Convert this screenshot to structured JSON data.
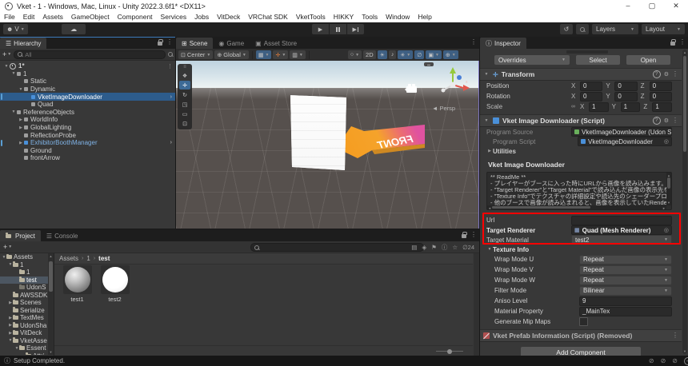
{
  "window": {
    "title": "Vket - 1 - Windows, Mac, Linux - Unity 2022.3.6f1* <DX11>",
    "minimize": "–",
    "maximize": "▢",
    "close": "✕"
  },
  "menubar": [
    "File",
    "Edit",
    "Assets",
    "GameObject",
    "Component",
    "Services",
    "Jobs",
    "VitDeck",
    "VRChat SDK",
    "VketTools",
    "HIKKY",
    "Tools",
    "Window",
    "Help"
  ],
  "toolbar": {
    "account_label": "V",
    "layers_label": "Layers",
    "layout_label": "Layout"
  },
  "hierarchy": {
    "tab": "Hierarchy",
    "search_placeholder": "All",
    "items": [
      {
        "label": "1*",
        "depth": 0,
        "arrow": "▼",
        "icon": "scene",
        "kebab": true
      },
      {
        "label": "1",
        "depth": 1,
        "arrow": "▼",
        "icon": "go"
      },
      {
        "label": "Static",
        "depth": 2,
        "arrow": "",
        "icon": "go"
      },
      {
        "label": "Dynamic",
        "depth": 2,
        "arrow": "▼",
        "icon": "go"
      },
      {
        "label": "VketImageDownloader",
        "depth": 3,
        "arrow": "",
        "icon": "prefab",
        "selected": true,
        "edge": true,
        "chevron": "›"
      },
      {
        "label": "Quad",
        "depth": 3,
        "arrow": "",
        "icon": "go"
      },
      {
        "label": "ReferenceObjects",
        "depth": 1,
        "arrow": "▼",
        "icon": "go"
      },
      {
        "label": "WorldInfo",
        "depth": 2,
        "arrow": "▶",
        "icon": "go"
      },
      {
        "label": "GlobalLighting",
        "depth": 2,
        "arrow": "▶",
        "icon": "go"
      },
      {
        "label": "ReflectionProbe",
        "depth": 2,
        "arrow": "",
        "icon": "go"
      },
      {
        "label": "ExhibitorBoothManager",
        "depth": 2,
        "arrow": "▶",
        "icon": "prefab",
        "blue": true,
        "edge": true,
        "chevron": "›"
      },
      {
        "label": "Ground",
        "depth": 2,
        "arrow": "",
        "icon": "go"
      },
      {
        "label": "frontArrow",
        "depth": 2,
        "arrow": "",
        "icon": "go"
      }
    ]
  },
  "scene": {
    "tabs": [
      {
        "label": "Scene",
        "active": true
      },
      {
        "label": "Game",
        "active": false
      },
      {
        "label": "Asset Store",
        "active": false
      }
    ],
    "toolbar": {
      "pivot": "Center",
      "orientation": "Global",
      "mode2d": "2D"
    },
    "persp_label": "Persp",
    "front_text": "FRONT"
  },
  "inspector": {
    "tab": "Inspector",
    "overrides_label": "Overrides",
    "select_label": "Select",
    "open_label": "Open",
    "transform": {
      "title": "Transform",
      "rows": [
        {
          "label": "Position",
          "x": "0",
          "y": "0",
          "z": "0",
          "link": false
        },
        {
          "label": "Rotation",
          "x": "0",
          "y": "0",
          "z": "0",
          "link": false
        },
        {
          "label": "Scale",
          "x": "1",
          "y": "1",
          "z": "1",
          "link": true
        }
      ]
    },
    "script": {
      "title": "Vket Image Downloader (Script)",
      "program_source_label": "Program Source",
      "program_source_value": "VketImageDownloader (Udon Sharp",
      "program_script_label": "Program Script",
      "program_script_value": "VketImageDownloader",
      "utilities_label": "Utilities",
      "box_title": "Vket Image Downloader",
      "readme_lines": [
        "** ReadMe **",
        "- プレイヤーがブースに入った時にURLから画像を読み込みます。",
        "- \"Target Renderer\"と\"Target Material\"で読み込んだ画像の表示先を指",
        "- \"Texture Info\"でテクスチャの詳細設定や読込先のシェーダープロパティを設定",
        "- 他のブースで画像が読み込まれると、画像を表示していたRendererは読み込"
      ],
      "url_label": "Url",
      "url_value": "",
      "target_renderer_label": "Target Renderer",
      "target_renderer_value": "Quad (Mesh Renderer)",
      "target_material_label": "Target Material",
      "target_material_value": "test2",
      "texture_info_label": "Texture Info",
      "props": [
        {
          "label": "Wrap Mode U",
          "value": "Repeat",
          "type": "dropdown"
        },
        {
          "label": "Wrap Mode V",
          "value": "Repeat",
          "type": "dropdown"
        },
        {
          "label": "Wrap Mode W",
          "value": "Repeat",
          "type": "dropdown"
        },
        {
          "label": "Filter Mode",
          "value": "Bilinear",
          "type": "dropdown"
        },
        {
          "label": "Aniso Level",
          "value": "9",
          "type": "input"
        },
        {
          "label": "Material Property",
          "value": "_MainTex",
          "type": "input"
        },
        {
          "label": "Generate Mip Maps",
          "value": "",
          "type": "checkbox"
        }
      ]
    },
    "removed_component": "Vket Prefab Information (Script) (Removed)",
    "add_component_label": "Add Component"
  },
  "project": {
    "tabs": [
      {
        "label": "Project",
        "active": true
      },
      {
        "label": "Console",
        "active": false
      }
    ],
    "breadcrumb": [
      "Assets",
      "1",
      "test"
    ],
    "tree": [
      {
        "label": "Assets",
        "depth": 0,
        "arrow": "▼"
      },
      {
        "label": "1",
        "depth": 1,
        "arrow": "▼"
      },
      {
        "label": "1",
        "depth": 2,
        "arrow": ""
      },
      {
        "label": "test",
        "depth": 2,
        "arrow": "",
        "selected": true
      },
      {
        "label": "UdonS",
        "depth": 2,
        "arrow": "",
        "empty": true
      },
      {
        "label": "AWSSDK",
        "depth": 1,
        "arrow": ""
      },
      {
        "label": "Scenes",
        "depth": 1,
        "arrow": "▶"
      },
      {
        "label": "Serialize",
        "depth": 1,
        "arrow": ""
      },
      {
        "label": "TextMes",
        "depth": 1,
        "arrow": "▶"
      },
      {
        "label": "UdonSha",
        "depth": 1,
        "arrow": "▶"
      },
      {
        "label": "VitDeck",
        "depth": 1,
        "arrow": "▶"
      },
      {
        "label": "VketAsse",
        "depth": 1,
        "arrow": "▼"
      },
      {
        "label": "Essent",
        "depth": 2,
        "arrow": "▼"
      },
      {
        "label": "Attri",
        "depth": 3,
        "arrow": ""
      }
    ],
    "assets": [
      {
        "name": "test1",
        "kind": "gray-sphere"
      },
      {
        "name": "test2",
        "kind": "white-sphere"
      }
    ],
    "hidden_count": "24"
  },
  "status": {
    "message": "Setup Completed."
  },
  "colors": {
    "accent": "#2d5c8c",
    "annotation": "#ff0000",
    "prefab_text": "#7fb2e5",
    "selection_blue": "#3d6a96"
  }
}
